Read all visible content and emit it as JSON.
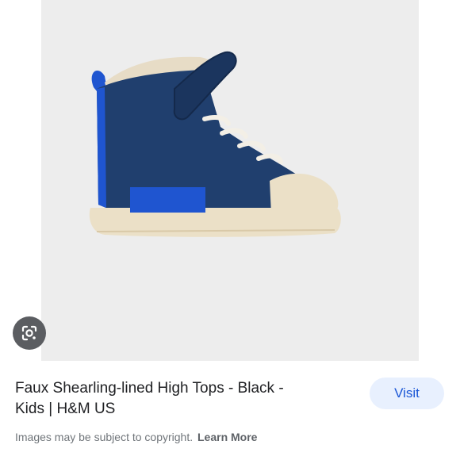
{
  "result": {
    "title_line1": "Faux Shearling-lined High Tops - Black -",
    "title_line2": "Kids | H&M US",
    "visit_label": "Visit",
    "copyright_text": "Images may be subject to copyright.",
    "learn_more_label": "Learn More"
  },
  "icons": {
    "lens": "google-lens-icon"
  },
  "colors": {
    "visit_bg": "#e8f0fe",
    "visit_text": "#1a56d6",
    "shoe_upper": "#203f6e",
    "shoe_accent": "#1f55d0",
    "sole": "#ebe0c7"
  }
}
